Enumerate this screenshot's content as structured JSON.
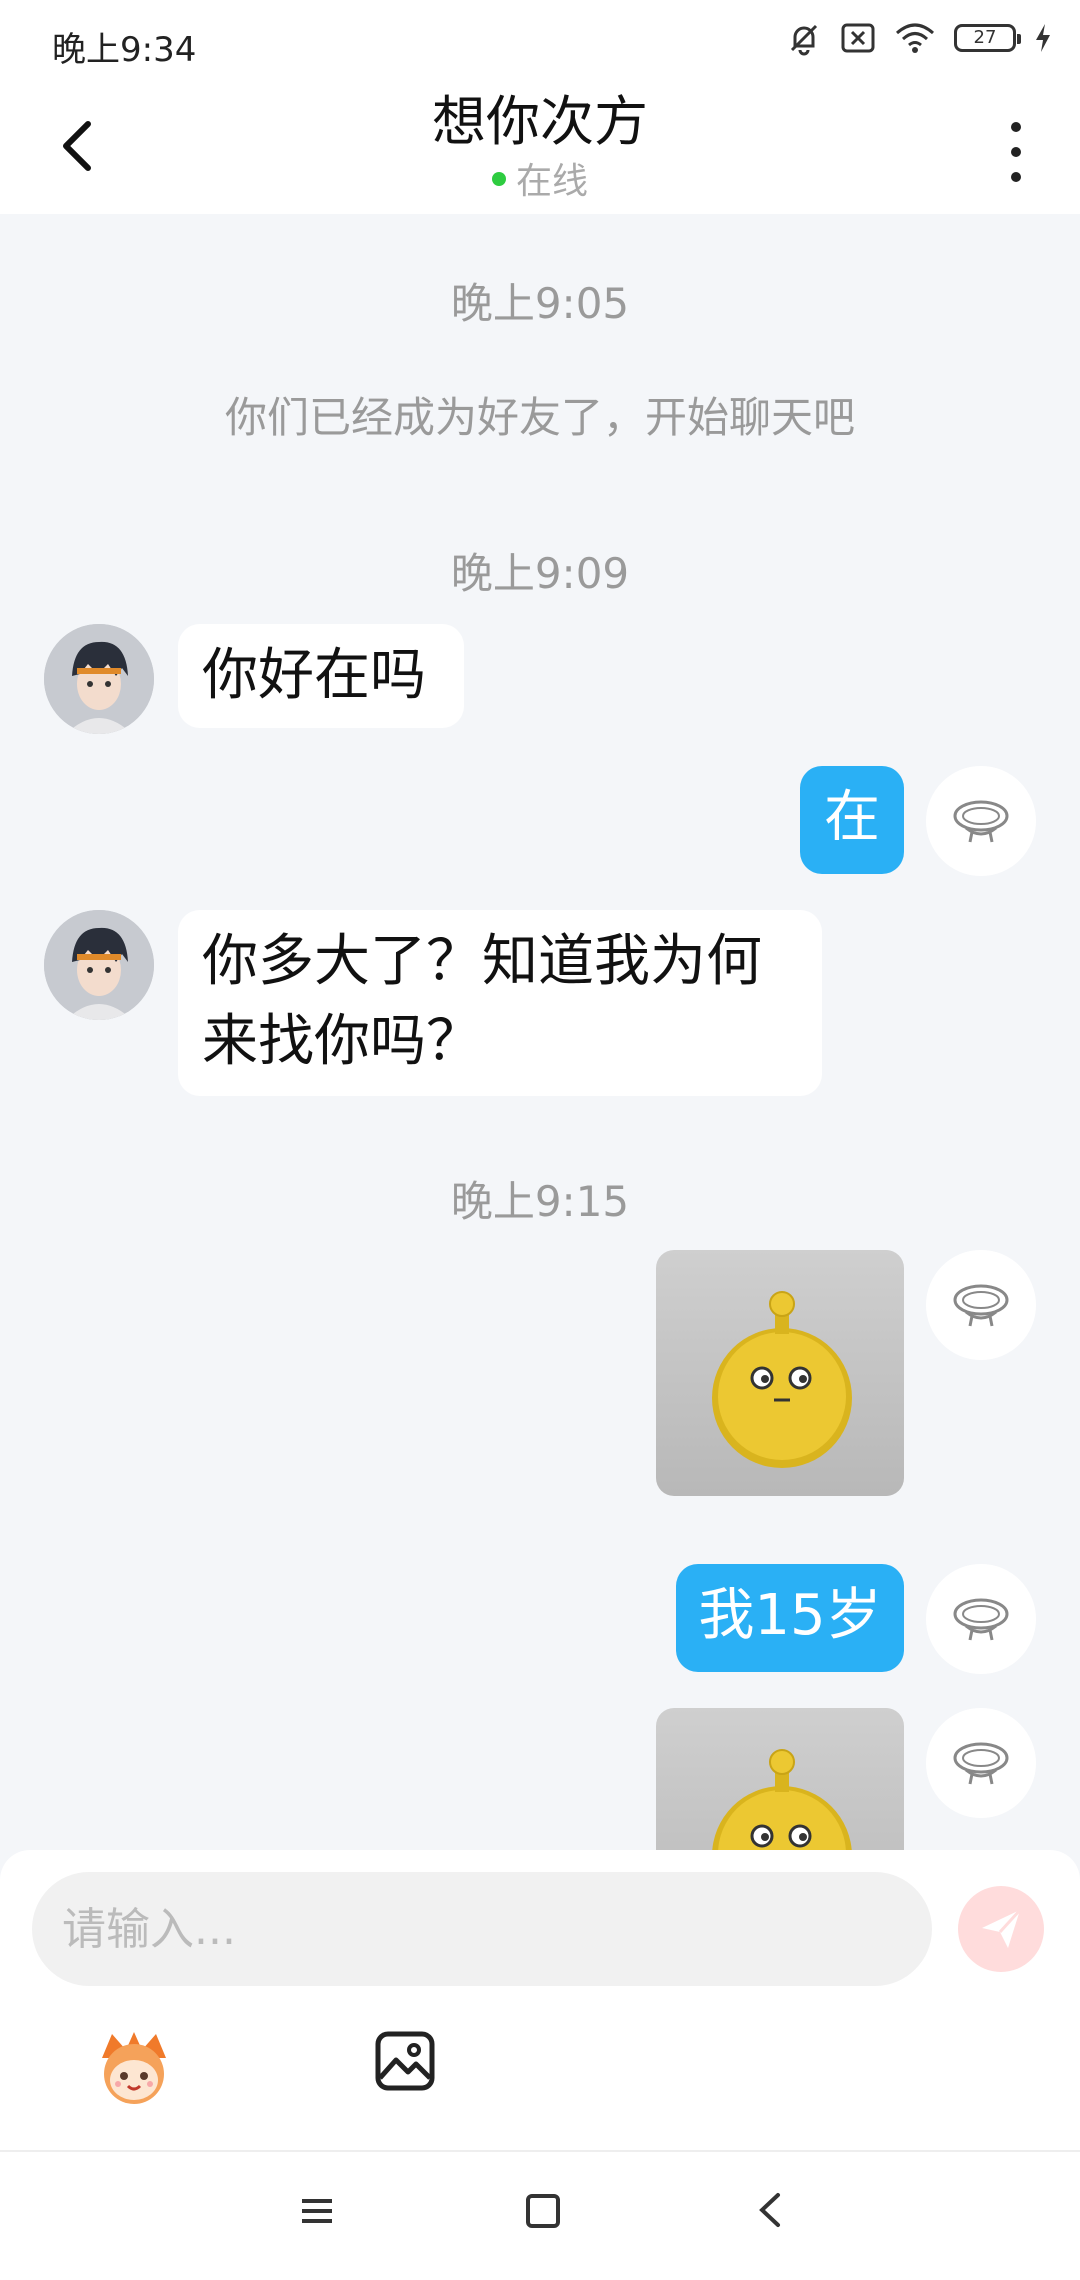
{
  "status_bar": {
    "time": "晚上9:34",
    "battery": "27"
  },
  "header": {
    "title": "想你次方",
    "online_status": "在线"
  },
  "chat": {
    "timestamps": [
      "晚上9:05",
      "晚上9:09",
      "晚上9:15"
    ],
    "system_message": "你们已经成为好友了，开始聊天吧",
    "messages": [
      {
        "from": "peer",
        "text": "你好在吗"
      },
      {
        "from": "self",
        "text": "在"
      },
      {
        "from": "peer",
        "text_line1": "你多大了？知道我为何",
        "text_line2": "来找你吗？"
      },
      {
        "from": "self",
        "type": "sticker"
      },
      {
        "from": "self",
        "text": "我15岁"
      },
      {
        "from": "self",
        "type": "sticker"
      }
    ]
  },
  "input": {
    "placeholder": "请输入..."
  },
  "colors": {
    "accent": "#2ab0f5",
    "online": "#2ecc40",
    "send_button": "#ffdcdc"
  },
  "icons": [
    "back-chevron",
    "more-dots",
    "send-plane",
    "emoji-face",
    "image",
    "menu",
    "home",
    "back"
  ]
}
